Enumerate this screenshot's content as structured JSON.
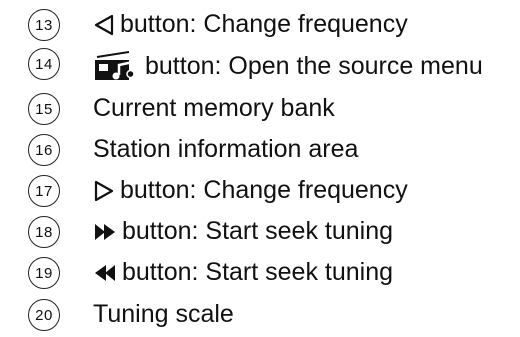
{
  "items": [
    {
      "number": "13",
      "icon": "triangle-left-outline-icon",
      "text": "button: Change frequency"
    },
    {
      "number": "14",
      "icon": "radio-music-source-icon",
      "text": "button: Open the source menu"
    },
    {
      "number": "15",
      "icon": "",
      "text": "Current memory bank"
    },
    {
      "number": "16",
      "icon": "",
      "text": "Station information area"
    },
    {
      "number": "17",
      "icon": "triangle-right-outline-icon",
      "text": "button: Change frequency"
    },
    {
      "number": "18",
      "icon": "seek-forward-icon",
      "text": "button: Start seek tuning"
    },
    {
      "number": "19",
      "icon": "seek-backward-icon",
      "text": "button: Start seek tuning"
    },
    {
      "number": "20",
      "icon": "",
      "text": "Tuning scale"
    }
  ]
}
